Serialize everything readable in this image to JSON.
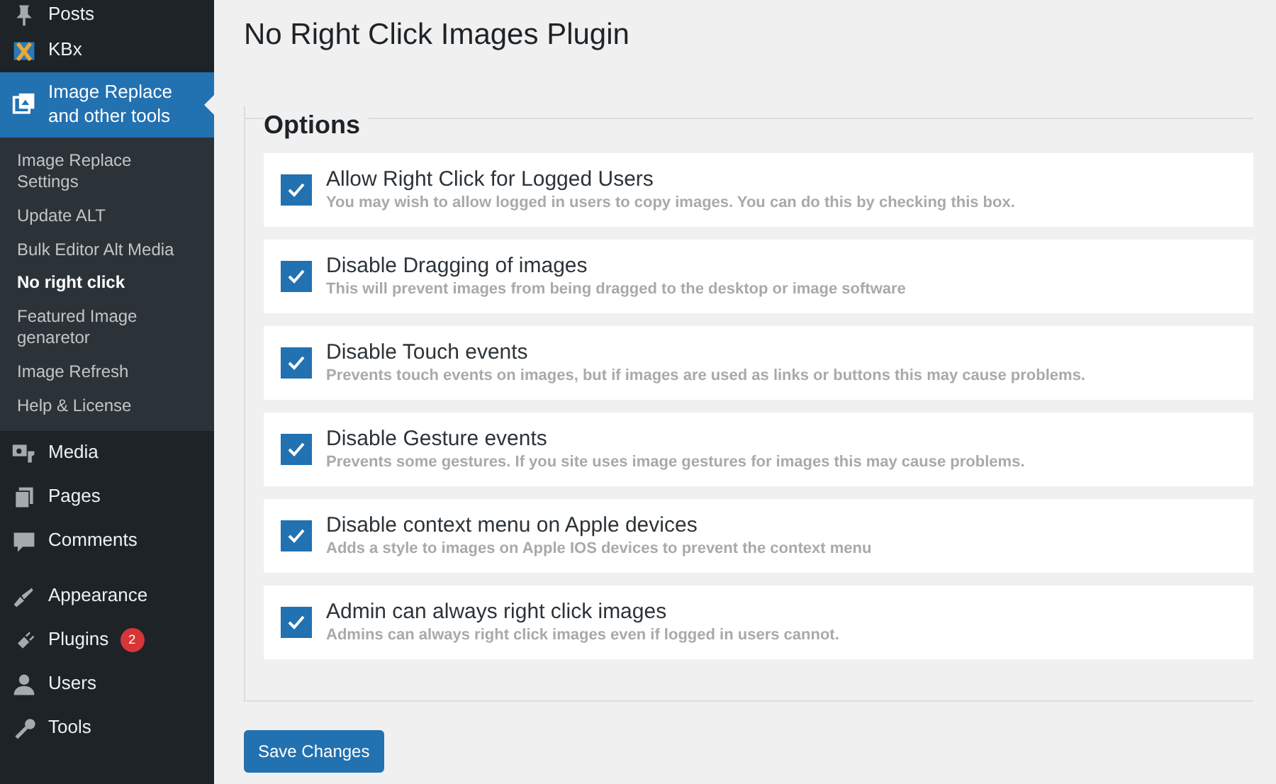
{
  "sidebar": {
    "items": [
      {
        "label": "Posts",
        "current": false
      },
      {
        "label": "KBx",
        "current": false
      },
      {
        "label": "Image Replace and other tools",
        "current": true,
        "submenu": [
          {
            "label": "Image Replace Settings",
            "selected": false
          },
          {
            "label": "Update ALT",
            "selected": false
          },
          {
            "label": "Bulk Editor Alt Media",
            "selected": false
          },
          {
            "label": "No right click",
            "selected": true
          },
          {
            "label": "Featured Image genaretor",
            "selected": false
          },
          {
            "label": "Image Refresh",
            "selected": false
          },
          {
            "label": "Help & License",
            "selected": false
          }
        ]
      },
      {
        "label": "Media",
        "current": false
      },
      {
        "label": "Pages",
        "current": false
      },
      {
        "label": "Comments",
        "current": false,
        "gap_after": true
      },
      {
        "label": "Appearance",
        "current": false
      },
      {
        "label": "Plugins",
        "current": false,
        "badge": "2"
      },
      {
        "label": "Users",
        "current": false
      },
      {
        "label": "Tools",
        "current": false
      }
    ]
  },
  "page_title": "No Right Click Images Plugin",
  "options": {
    "legend": "Options",
    "rows": [
      {
        "label": "Allow Right Click for Logged Users",
        "description": "You may wish to allow logged in users to copy images. You can do this by checking this box.",
        "checked": true
      },
      {
        "label": "Disable Dragging of images",
        "description": "This will prevent images from being dragged to the desktop or image software",
        "checked": true
      },
      {
        "label": "Disable Touch events",
        "description": "Prevents touch events on images, but if images are used as links or buttons this may cause problems.",
        "checked": true
      },
      {
        "label": "Disable Gesture events",
        "description": "Prevents some gestures. If you site uses image gestures for images this may cause problems.",
        "checked": true
      },
      {
        "label": "Disable context menu on Apple devices",
        "description": "Adds a style to images on Apple IOS devices to prevent the context menu",
        "checked": true
      },
      {
        "label": "Admin can always right click images",
        "description": "Admins can always right click images even if logged in users cannot.",
        "checked": true
      }
    ]
  },
  "save_button": "Save Changes"
}
